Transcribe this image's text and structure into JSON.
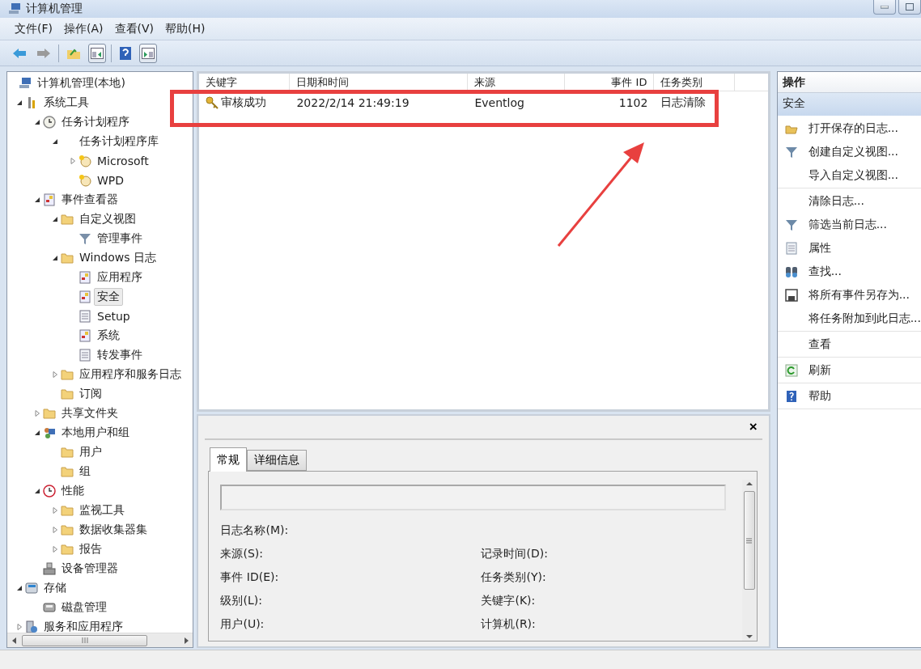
{
  "window": {
    "title": "计算机管理"
  },
  "menu": [
    "文件(F)",
    "操作(A)",
    "查看(V)",
    "帮助(H)"
  ],
  "tree": [
    {
      "label": "计算机管理(本地)",
      "kind": "computer",
      "selected": false,
      "children": [
        {
          "label": "系统工具",
          "kind": "tools",
          "expanded": true,
          "selected": false,
          "children": [
            {
              "label": "任务计划程序",
              "kind": "clock",
              "expanded": true,
              "selected": false,
              "children": [
                {
                  "label": "任务计划程序库",
                  "kind": "blank",
                  "expanded": true,
                  "selected": false,
                  "children": [
                    {
                      "label": "Microsoft",
                      "kind": "task",
                      "expanded": false,
                      "selected": false
                    },
                    {
                      "label": "WPD",
                      "kind": "task",
                      "selected": false
                    }
                  ]
                }
              ]
            },
            {
              "label": "事件查看器",
              "kind": "viewer",
              "expanded": true,
              "selected": false,
              "children": [
                {
                  "label": "自定义视图",
                  "kind": "folder",
                  "expanded": true,
                  "selected": false,
                  "children": [
                    {
                      "label": "管理事件",
                      "kind": "filter",
                      "selected": false
                    }
                  ]
                },
                {
                  "label": "Windows 日志",
                  "kind": "folder",
                  "expanded": true,
                  "selected": false,
                  "children": [
                    {
                      "label": "应用程序",
                      "kind": "log",
                      "selected": false
                    },
                    {
                      "label": "安全",
                      "kind": "log",
                      "selected": true
                    },
                    {
                      "label": "Setup",
                      "kind": "plainlog",
                      "selected": false
                    },
                    {
                      "label": "系统",
                      "kind": "log",
                      "selected": false
                    },
                    {
                      "label": "转发事件",
                      "kind": "plainlog",
                      "selected": false
                    }
                  ]
                },
                {
                  "label": "应用程序和服务日志",
                  "kind": "folder",
                  "expanded": false,
                  "selected": false
                },
                {
                  "label": "订阅",
                  "kind": "folder",
                  "selected": false
                }
              ]
            },
            {
              "label": "共享文件夹",
              "kind": "folder",
              "expanded": false,
              "selected": false
            },
            {
              "label": "本地用户和组",
              "kind": "users",
              "expanded": true,
              "selected": false,
              "children": [
                {
                  "label": "用户",
                  "kind": "folder",
                  "selected": false
                },
                {
                  "label": "组",
                  "kind": "folder",
                  "selected": false
                }
              ]
            },
            {
              "label": "性能",
              "kind": "gauge",
              "expanded": true,
              "selected": false,
              "children": [
                {
                  "label": "监视工具",
                  "kind": "folder",
                  "expanded": false,
                  "selected": false
                },
                {
                  "label": "数据收集器集",
                  "kind": "folder",
                  "expanded": false,
                  "selected": false
                },
                {
                  "label": "报告",
                  "kind": "folder",
                  "expanded": false,
                  "selected": false
                }
              ]
            },
            {
              "label": "设备管理器",
              "kind": "device",
              "selected": false
            }
          ]
        },
        {
          "label": "存储",
          "kind": "storage",
          "expanded": true,
          "selected": false,
          "children": [
            {
              "label": "磁盘管理",
              "kind": "disk",
              "selected": false
            }
          ]
        },
        {
          "label": "服务和应用程序",
          "kind": "services",
          "expanded": false,
          "selected": false
        }
      ]
    }
  ],
  "table": {
    "columns": [
      "关键字",
      "日期和时间",
      "来源",
      "事件 ID",
      "任务类别"
    ],
    "rows": [
      {
        "cells": [
          "审核成功",
          "2022/2/14 21:49:19",
          "Eventlog",
          "1102",
          "日志清除"
        ],
        "selected": false
      }
    ]
  },
  "details": {
    "close": "×",
    "tabs": [
      {
        "label": "常规",
        "selected": true
      },
      {
        "label": "详细信息",
        "selected": false
      }
    ],
    "fields": [
      {
        "left": "日志名称(M):"
      },
      {
        "left": "来源(S):",
        "right": "记录时间(D):"
      },
      {
        "left": "事件 ID(E):",
        "right": "任务类别(Y):"
      },
      {
        "left": "级别(L):",
        "right": "关键字(K):"
      },
      {
        "left": "用户(U):",
        "right": "计算机(R):"
      }
    ]
  },
  "actions": {
    "title": "操作",
    "section": "安全",
    "groups": [
      [
        {
          "label": "打开保存的日志...",
          "kind": "open"
        },
        {
          "label": "创建自定义视图...",
          "kind": "filter"
        },
        {
          "label": "导入自定义视图...",
          "kind": "none"
        }
      ],
      [
        {
          "label": "清除日志...",
          "kind": "none"
        },
        {
          "label": "筛选当前日志...",
          "kind": "filter"
        },
        {
          "label": "属性",
          "kind": "props"
        },
        {
          "label": "查找...",
          "kind": "find"
        },
        {
          "label": "将所有事件另存为...",
          "kind": "save"
        },
        {
          "label": "将任务附加到此日志...",
          "kind": "none"
        }
      ],
      [
        {
          "label": "查看",
          "kind": "none"
        }
      ],
      [
        {
          "label": "刷新",
          "kind": "refresh"
        }
      ],
      [
        {
          "label": "帮助",
          "kind": "help"
        }
      ]
    ]
  }
}
